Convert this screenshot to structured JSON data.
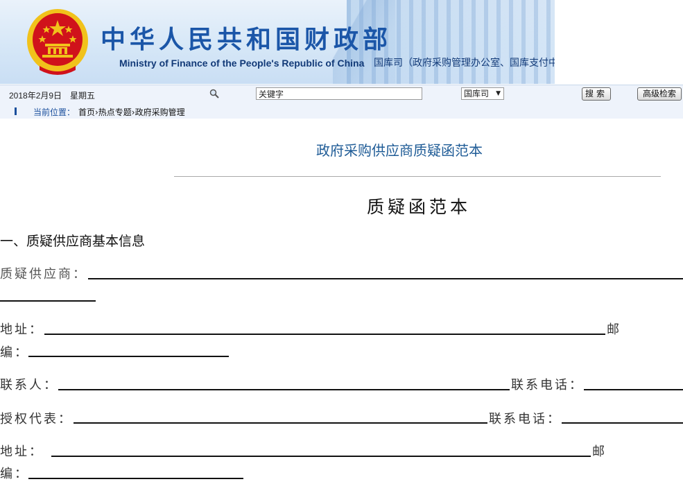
{
  "header": {
    "title_cn": "中华人民共和国财政部",
    "title_en": "Ministry of Finance of the People's Republic of China",
    "department": "国库司（政府采购管理办公室、国库支付中心）"
  },
  "toolbar": {
    "date": "2018年2月9日　星期五",
    "search_value": "关键字",
    "scope_selected": "国库司",
    "search_button": "搜索",
    "advanced_button": "高级检索"
  },
  "breadcrumb": {
    "label": "当前位置：",
    "path": "首页›热点专题›政府采购管理"
  },
  "article": {
    "title": "政府采购供应商质疑函范本",
    "doc_title": "质疑函范本",
    "section1": "一、质疑供应商基本信息",
    "fields": {
      "supplier": "质疑供应商：",
      "address": "地址：",
      "postcode_a": "邮",
      "postcode_b": "编：",
      "contact": "联系人：",
      "phone": "联系电话：",
      "authorized": "授权代表：",
      "phone2": "联系电话：",
      "address2": "地址：",
      "postcode2_a": "邮",
      "postcode2_b": "编："
    }
  },
  "colors": {
    "brand_blue": "#1b56a8",
    "title_blue": "#1e5b96",
    "emblem_red": "#d0121b",
    "emblem_gold": "#f1c21b"
  }
}
